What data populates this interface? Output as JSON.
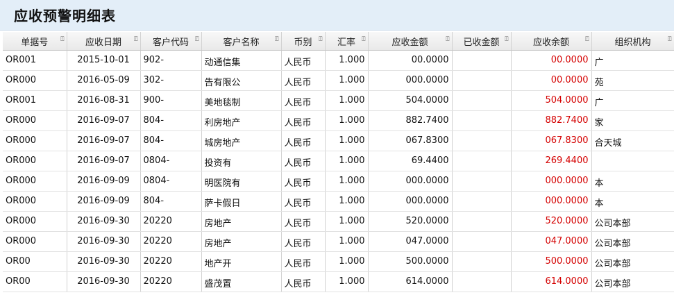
{
  "page": {
    "title": "应收预警明细表"
  },
  "columns": [
    {
      "key": "doc_no",
      "label": "单据号"
    },
    {
      "key": "date",
      "label": "应收日期"
    },
    {
      "key": "cust_code",
      "label": "客户代码"
    },
    {
      "key": "cust_name",
      "label": "客户名称"
    },
    {
      "key": "currency",
      "label": "币别"
    },
    {
      "key": "rate",
      "label": "汇率"
    },
    {
      "key": "recv_amt",
      "label": "应收金额"
    },
    {
      "key": "paid_amt",
      "label": "已收金额"
    },
    {
      "key": "balance",
      "label": "应收余额"
    },
    {
      "key": "org",
      "label": "组织机构"
    }
  ],
  "rows": [
    {
      "doc_no": "OR001",
      "date": "2015-10-01",
      "cust_code": "902-",
      "cust_name": "动通信集",
      "currency": "人民币",
      "rate": "1.000",
      "recv_amt": "00.0000",
      "paid_amt": "",
      "balance": "00.0000",
      "org": "广"
    },
    {
      "doc_no": "OR000",
      "date": "2016-05-09",
      "cust_code": "302-",
      "cust_name": "告有限公",
      "currency": "人民币",
      "rate": "1.000",
      "recv_amt": "000.0000",
      "paid_amt": "",
      "balance": "00.0000",
      "org": "苑"
    },
    {
      "doc_no": "OR001",
      "date": "2016-08-31",
      "cust_code": "900-",
      "cust_name": "美地毯制",
      "currency": "人民币",
      "rate": "1.000",
      "recv_amt": "504.0000",
      "paid_amt": "",
      "balance": "504.0000",
      "org": "广"
    },
    {
      "doc_no": "OR000",
      "date": "2016-09-07",
      "cust_code": "804-",
      "cust_name": "利房地产",
      "currency": "人民币",
      "rate": "1.000",
      "recv_amt": "882.7400",
      "paid_amt": "",
      "balance": "882.7400",
      "org": "家"
    },
    {
      "doc_no": "OR000",
      "date": "2016-09-07",
      "cust_code": "804-",
      "cust_name": "城房地产",
      "currency": "人民币",
      "rate": "1.000",
      "recv_amt": "067.8300",
      "paid_amt": "",
      "balance": "067.8300",
      "org": "合天城"
    },
    {
      "doc_no": "OR000",
      "date": "2016-09-07",
      "cust_code": "0804-",
      "cust_name": "投资有",
      "currency": "人民币",
      "rate": "1.000",
      "recv_amt": "69.4400",
      "paid_amt": "",
      "balance": "269.4400",
      "org": ""
    },
    {
      "doc_no": "OR000",
      "date": "2016-09-09",
      "cust_code": "0804-",
      "cust_name": "明医院有",
      "currency": "人民币",
      "rate": "1.000",
      "recv_amt": "000.0000",
      "paid_amt": "",
      "balance": "000.0000",
      "org": "本"
    },
    {
      "doc_no": "OR000",
      "date": "2016-09-09",
      "cust_code": "804-",
      "cust_name": "萨卡假日",
      "currency": "人民币",
      "rate": "1.000",
      "recv_amt": "000.0000",
      "paid_amt": "",
      "balance": "000.0000",
      "org": "本"
    },
    {
      "doc_no": "OR000",
      "date": "2016-09-30",
      "cust_code": "20220",
      "cust_name": "房地产",
      "currency": "人民币",
      "rate": "1.000",
      "recv_amt": "520.0000",
      "paid_amt": "",
      "balance": "520.0000",
      "org": "公司本部"
    },
    {
      "doc_no": "OR000",
      "date": "2016-09-30",
      "cust_code": "20220",
      "cust_name": "房地产",
      "currency": "人民币",
      "rate": "1.000",
      "recv_amt": "047.0000",
      "paid_amt": "",
      "balance": "047.0000",
      "org": "公司本部"
    },
    {
      "doc_no": "OR00",
      "date": "2016-09-30",
      "cust_code": "20220",
      "cust_name": "地产开",
      "currency": "人民币",
      "rate": "1.000",
      "recv_amt": "500.0000",
      "paid_amt": "",
      "balance": "500.0000",
      "org": "公司本部"
    },
    {
      "doc_no": "OR00",
      "date": "2016-09-30",
      "cust_code": "20220",
      "cust_name": "盛茂置",
      "currency": "人民币",
      "rate": "1.000",
      "recv_amt": "614.0000",
      "paid_amt": "",
      "balance": "614.0000",
      "org": "公司本部"
    }
  ]
}
